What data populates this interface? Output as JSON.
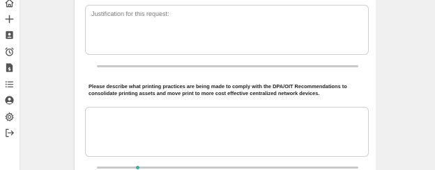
{
  "sidebar": {
    "items": [
      {
        "icon": "home-icon"
      },
      {
        "icon": "plus-icon"
      },
      {
        "icon": "contact-card-icon"
      },
      {
        "icon": "alarm-clock-icon"
      },
      {
        "icon": "invoice-dollar-icon"
      },
      {
        "icon": "list-icon"
      },
      {
        "icon": "user-circle-icon"
      },
      {
        "icon": "gear-icon"
      },
      {
        "icon": "sign-out-icon"
      }
    ]
  },
  "form": {
    "justification": {
      "placeholder": "Justification for this request:",
      "value": ""
    },
    "printing_question": "Please describe what printing practices are being made to comply with the DPA/OIT Recommendations to consolidate printing assets and move print to more cost effective centralized network devices.",
    "printing_answer": {
      "placeholder": "",
      "value": ""
    }
  },
  "colors": {
    "icon": "#555555",
    "divider": "#c9c9c9",
    "accent": "#2bb5a8"
  }
}
